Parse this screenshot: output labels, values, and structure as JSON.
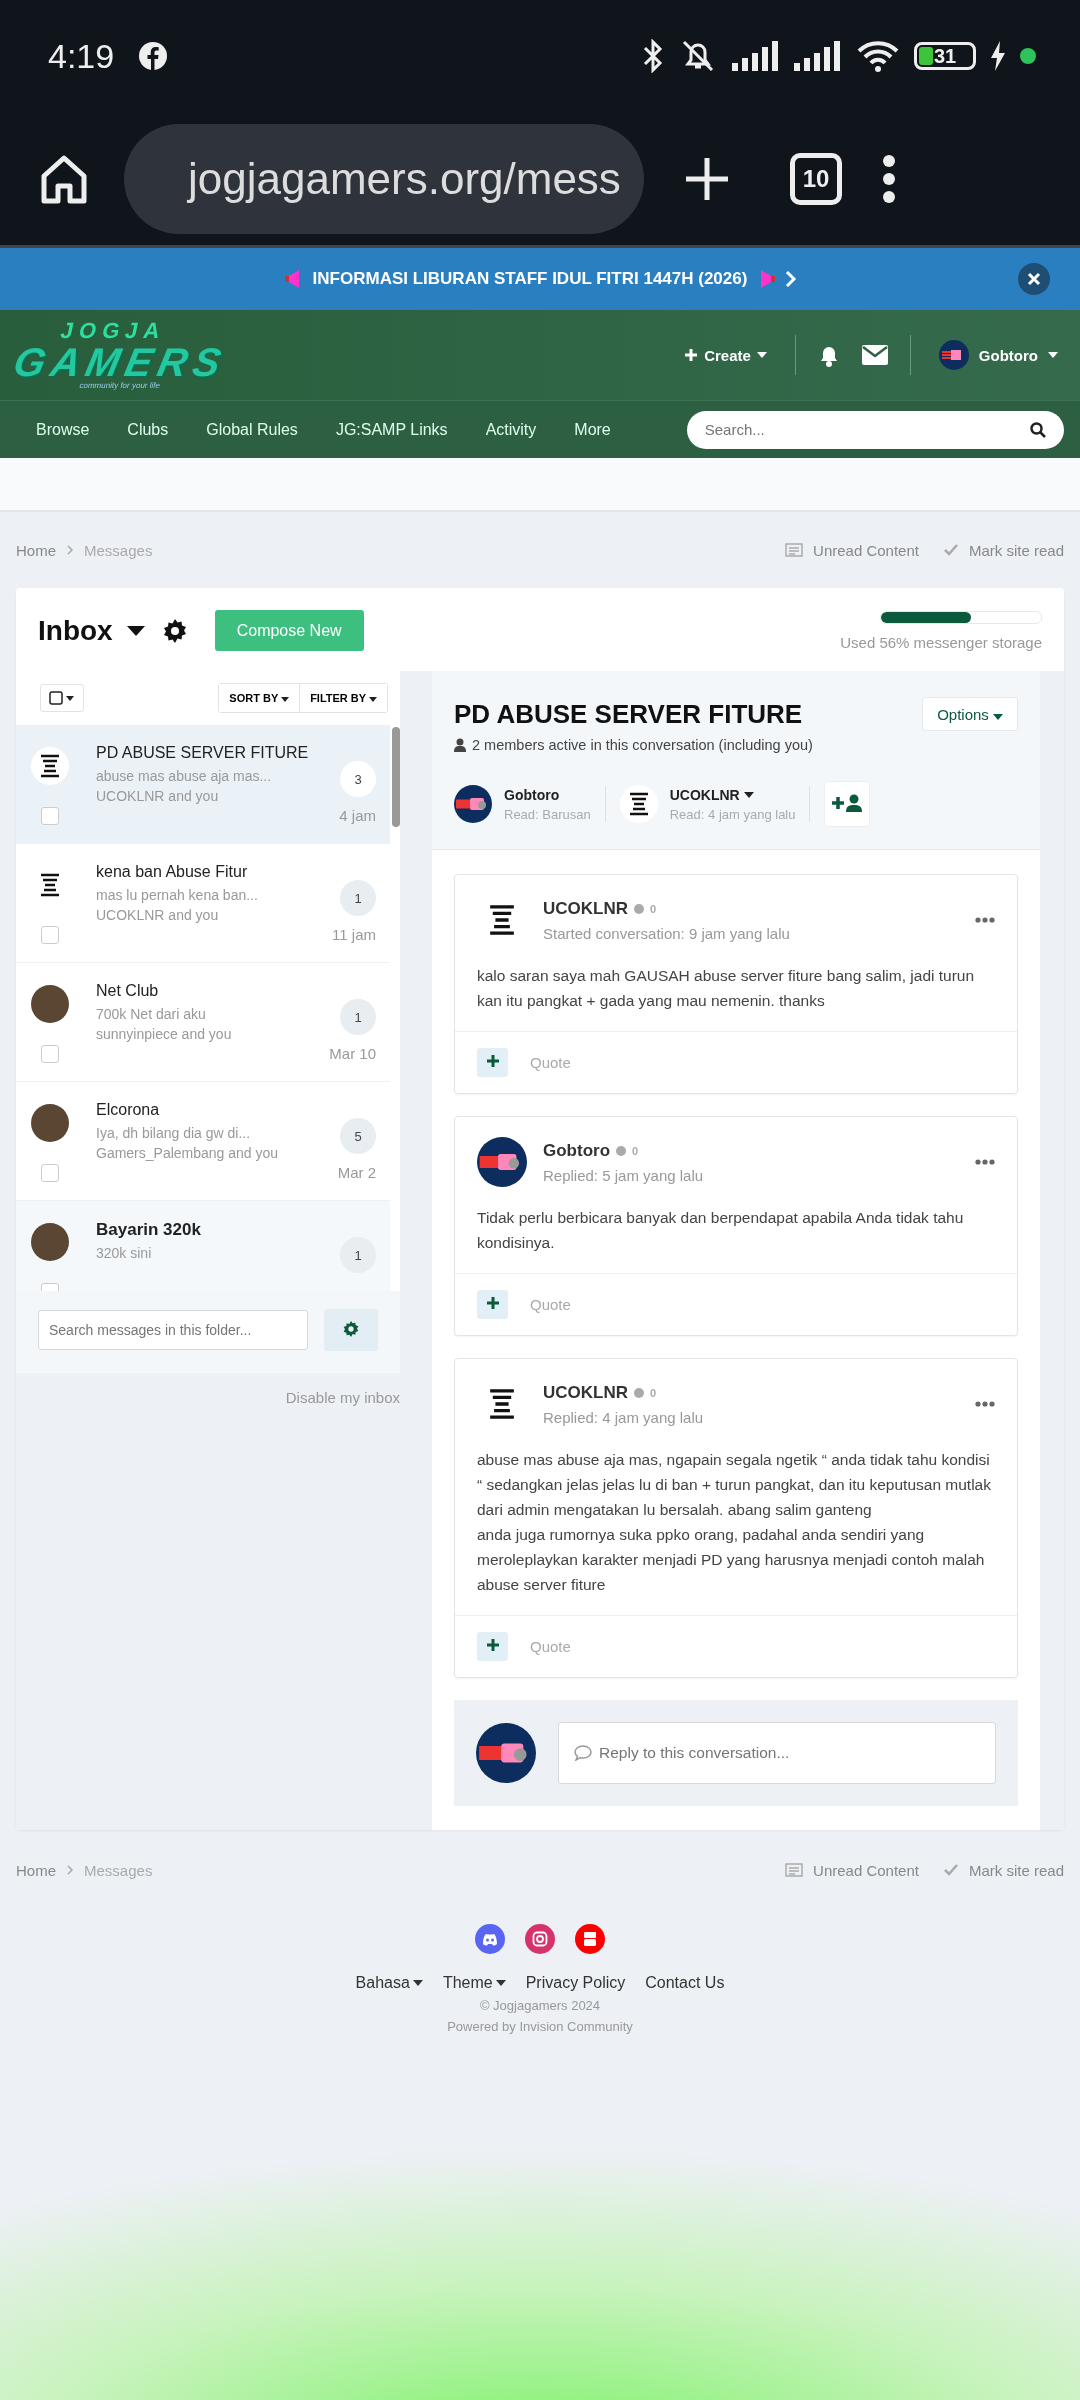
{
  "status_bar": {
    "time": "4:19",
    "battery": "31"
  },
  "browser": {
    "url": "jogjagamers.org/mess",
    "tab_count": "10"
  },
  "banner": {
    "text": "INFORMASI LIBURAN STAFF IDUL FITRI 1447H (2026)"
  },
  "header": {
    "logo": {
      "line1": "JOGJA",
      "line2": "GAMERS",
      "tagline": "community for your life"
    },
    "create": "Create",
    "user": "Gobtoro"
  },
  "nav": {
    "items": [
      "Browse",
      "Clubs",
      "Global Rules",
      "JG:SAMP Links",
      "Activity",
      "More"
    ],
    "search_placeholder": "Search..."
  },
  "breadcrumb": {
    "items": [
      "Home",
      "Messages"
    ],
    "actions": [
      "Unread Content",
      "Mark site read"
    ]
  },
  "inbox": {
    "title": "Inbox",
    "compose": "Compose New",
    "storage": {
      "level": 0.56,
      "label": "Used 56% messenger storage"
    }
  },
  "list": {
    "sort": "SORT BY",
    "filter": "FILTER BY",
    "items": [
      {
        "title": "PD ABUSE SERVER FITURE",
        "snippet": "abuse mas abuse aja mas...",
        "members": "UCOKLNR and you",
        "count": "3",
        "time": "4 jam",
        "avatar": {
          "kind": "sticker"
        },
        "selected": true,
        "unread": false
      },
      {
        "title": "kena ban Abuse Fitur",
        "snippet": "mas lu pernah kena ban...",
        "members": "UCOKLNR and you",
        "count": "1",
        "time": "11 jam",
        "avatar": {
          "kind": "sticker"
        },
        "selected": false,
        "unread": false
      },
      {
        "title": "Net Club",
        "snippet": "700k Net dari aku",
        "members": "sunnyinpiece and you",
        "count": "1",
        "time": "Mar 10",
        "avatar": {
          "kind": "photo"
        },
        "selected": false,
        "unread": false
      },
      {
        "title": "Elcorona",
        "snippet": "Iya, dh bilang dia gw di...",
        "members": "Gamers_Palembang and you",
        "count": "5",
        "time": "Mar 2",
        "avatar": {
          "kind": "photo"
        },
        "selected": false,
        "unread": false
      },
      {
        "title": "Bayarin 320k",
        "snippet": "320k sini",
        "count": "1",
        "avatar": {
          "kind": "photo"
        },
        "selected": false,
        "unread": true
      }
    ],
    "search_placeholder": "Search messages in this folder...",
    "disable": "Disable my inbox"
  },
  "conversation": {
    "title": "PD ABUSE SERVER FITURE",
    "options": "Options",
    "active": "2 members active in this conversation (including you)",
    "participants": [
      {
        "name": "Gobtoro",
        "read": "Read: Barusan",
        "avatar": {
          "kind": "cat"
        },
        "menu": false
      },
      {
        "name": "UCOKLNR",
        "read": "Read: 4 jam yang lalu",
        "avatar": {
          "kind": "sticker"
        },
        "menu": true
      }
    ],
    "posts": [
      {
        "author": "UCOKLNR",
        "rep": "0",
        "meta": "Started conversation: 9 jam yang lalu",
        "avatar": {
          "kind": "sticker"
        },
        "body": [
          "kalo saran saya mah GAUSAH abuse server fiture bang salim, jadi turun kan itu pangkat + gada yang mau nemenin. thanks"
        ],
        "quote": "Quote"
      },
      {
        "author": "Gobtoro",
        "rep": "0",
        "meta": "Replied: 5 jam yang lalu",
        "avatar": {
          "kind": "cat"
        },
        "body": [
          "Tidak perlu berbicara banyak dan berpendapat apabila Anda tidak tahu kondisinya."
        ],
        "quote": "Quote"
      },
      {
        "author": "UCOKLNR",
        "rep": "0",
        "meta": "Replied: 4 jam yang lalu",
        "avatar": {
          "kind": "sticker"
        },
        "body": [
          "abuse mas abuse aja mas, ngapain segala ngetik “ anda tidak tahu kondisi “ sedangkan jelas jelas lu di ban + turun pangkat, dan itu keputusan mutlak dari admin mengatakan lu bersalah. abang salim ganteng",
          "anda juga rumornya suka ppko orang, padahal anda sendiri yang meroleplaykan karakter menjadi PD yang harusnya menjadi contoh malah abuse server fiture"
        ],
        "quote": "Quote"
      }
    ],
    "reply_placeholder": "Reply to this conversation..."
  },
  "footer": {
    "breadcrumb": [
      "Home",
      "Messages"
    ],
    "actions": [
      "Unread Content",
      "Mark site read"
    ],
    "links": [
      {
        "label": "Bahasa",
        "menu": true
      },
      {
        "label": "Theme",
        "menu": true
      },
      {
        "label": "Privacy Policy",
        "menu": false
      },
      {
        "label": "Contact Us",
        "menu": false
      }
    ],
    "copyright": "© Jogjagamers 2024",
    "powered": "Powered by Invision Community"
  }
}
